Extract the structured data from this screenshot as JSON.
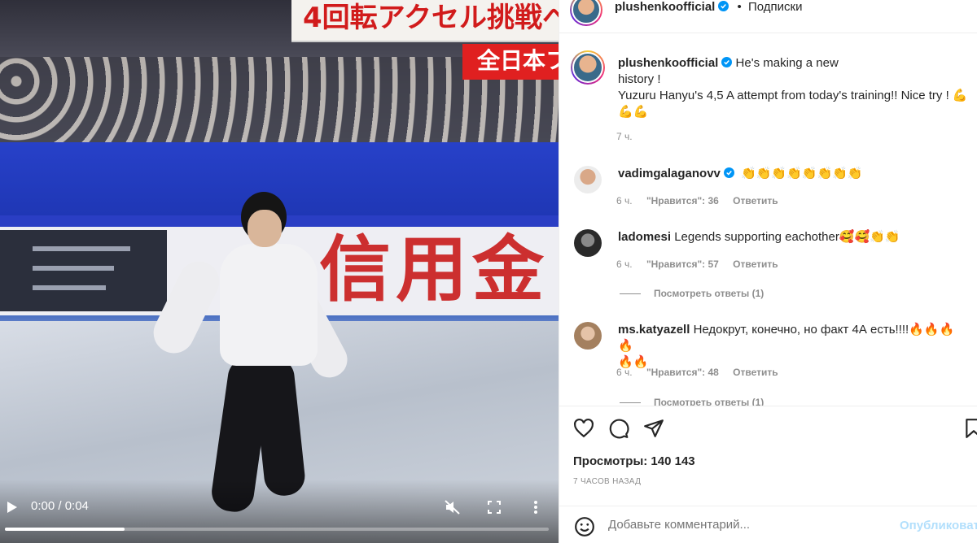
{
  "video": {
    "banner_jp_top": "4回転アクセル挑戦へ",
    "banner_jp_red": "全日本フ",
    "rink_sign_jp": "信用金",
    "time_display": "0:00 / 0:04",
    "progress": 0.22,
    "controls": {
      "play": "play-icon",
      "mute": "muted-icon",
      "fullscreen": "fullscreen-icon",
      "more": "more-vertical-icon"
    }
  },
  "post": {
    "author": "plushenkoofficial",
    "follow_text": "Подписки",
    "separator": "•",
    "caption_line1": "He's making a new",
    "caption_line2": "history !",
    "caption_line3": "Yuzuru Hanyu's 4,5 A attempt from today's training!! Nice try ! 💪",
    "caption_line4": "💪💪",
    "caption_time": "7 ч.",
    "views_label": "Просмотры: 140 143",
    "time_ago": "7 ЧАСОВ НАЗАД",
    "add_comment_placeholder": "Добавьте комментарий...",
    "publish_label": "Опубликовать"
  },
  "comments": [
    {
      "user": "vadimgalaganovv",
      "verified": true,
      "text": "👏👏👏👏👏👏👏👏",
      "time": "6 ч.",
      "likes": "\"Нравится\": 36",
      "reply": "Ответить"
    },
    {
      "user": "ladomesi",
      "verified": false,
      "text": "Legends supporting eachother🥰🥰👏👏",
      "time": "6 ч.",
      "likes": "\"Нравится\": 57",
      "reply": "Ответить",
      "view_replies": "Посмотреть ответы (1)"
    },
    {
      "user": "ms.katyazell",
      "verified": false,
      "text": "Недокрут, конечно, но факт 4А есть!!!!🔥🔥🔥🔥",
      "text_line2": "🔥🔥",
      "time": "6 ч.",
      "likes": "\"Нравится\": 48",
      "reply": "Ответить",
      "view_replies": "Посмотреть ответы (1)"
    }
  ],
  "colors": {
    "verified_blue": "#0095f6",
    "publish_disabled": "#b2dffc",
    "secondary_text": "#8e8e8e"
  }
}
